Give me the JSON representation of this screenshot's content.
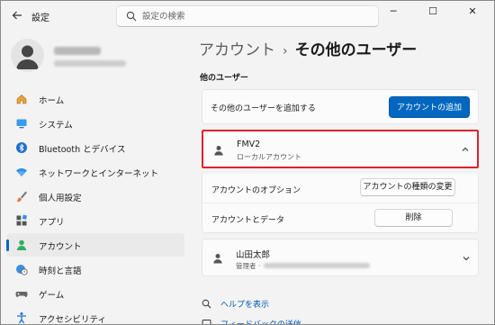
{
  "window": {
    "title": "設定",
    "controls": {
      "minimize": "─",
      "maximize": "☐",
      "close": "✕"
    }
  },
  "search": {
    "placeholder": "設定の検索",
    "value": ""
  },
  "profile": {
    "name_redacted": "",
    "email_redacted": ""
  },
  "sidebar": {
    "items": [
      {
        "label": "ホーム",
        "icon": "home-icon"
      },
      {
        "label": "システム",
        "icon": "system-icon"
      },
      {
        "label": "Bluetooth とデバイス",
        "icon": "bluetooth-icon"
      },
      {
        "label": "ネットワークとインターネット",
        "icon": "wifi-icon"
      },
      {
        "label": "個人用設定",
        "icon": "brush-icon"
      },
      {
        "label": "アプリ",
        "icon": "apps-icon"
      },
      {
        "label": "アカウント",
        "icon": "account-icon",
        "selected": true
      },
      {
        "label": "時刻と言語",
        "icon": "globe-clock-icon"
      },
      {
        "label": "ゲーム",
        "icon": "gamepad-icon"
      },
      {
        "label": "アクセシビリティ",
        "icon": "accessibility-icon"
      }
    ]
  },
  "breadcrumb": {
    "parent": "アカウント",
    "separator": "›",
    "current": "その他のユーザー"
  },
  "section_title": "他のユーザー",
  "add_user": {
    "label": "その他のユーザーを追加する",
    "button": "アカウントの追加"
  },
  "users": [
    {
      "name": "FMV2",
      "type": "ローカルアカウント",
      "expanded": true,
      "options": {
        "account_options_label": "アカウントのオプション",
        "change_type_button": "アカウントの種類の変更",
        "account_data_label": "アカウントとデータ",
        "delete_button": "削除"
      }
    },
    {
      "name": "山田太郎",
      "type": "管理者 ·",
      "expanded": false
    }
  ],
  "links": {
    "help": "ヘルプを表示",
    "feedback": "フィードバックの送信"
  },
  "colors": {
    "accent": "#0067c0",
    "highlight_border": "#e0202a",
    "link": "#0059b3"
  }
}
